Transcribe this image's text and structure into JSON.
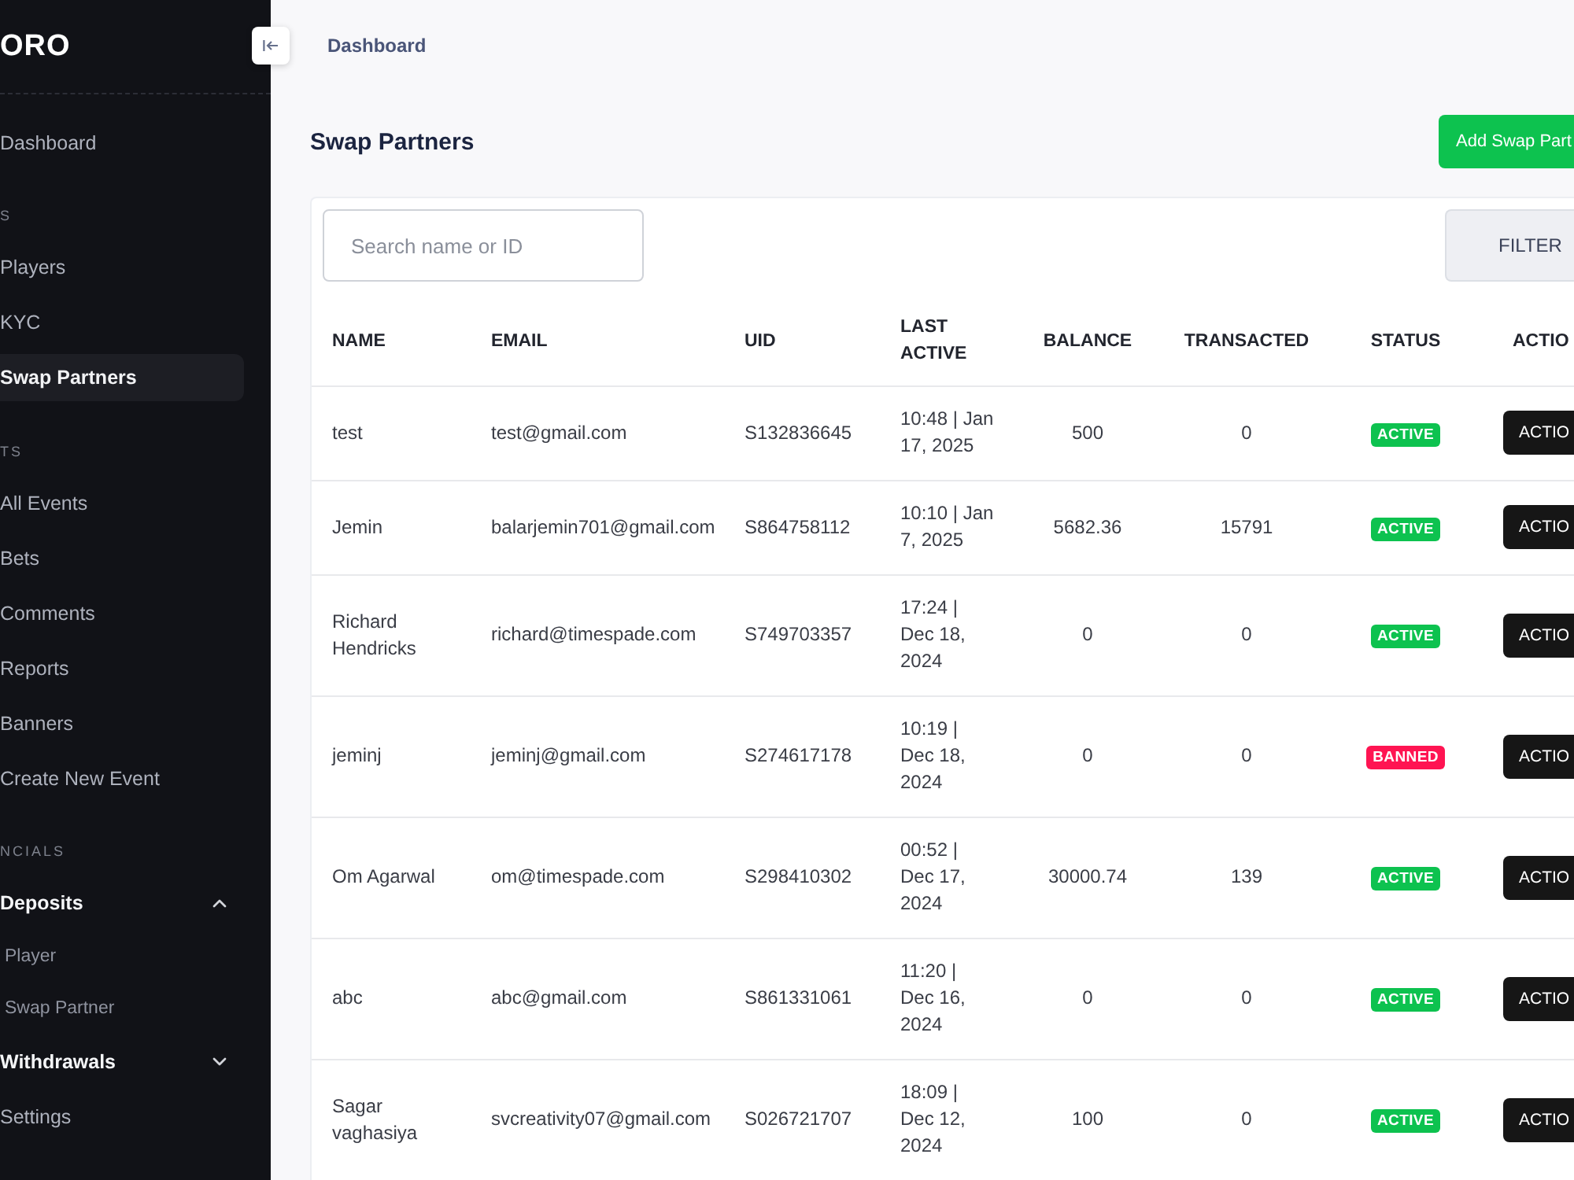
{
  "sidebar": {
    "logo": "ORO",
    "items": [
      {
        "kind": "link",
        "label": "Dashboard",
        "selected": false
      },
      {
        "kind": "section",
        "label": "S"
      },
      {
        "kind": "link",
        "label": "Players",
        "selected": false
      },
      {
        "kind": "link",
        "label": "KYC",
        "selected": false
      },
      {
        "kind": "link",
        "label": "Swap Partners",
        "selected": true
      },
      {
        "kind": "section",
        "label": "TS"
      },
      {
        "kind": "link",
        "label": "All Events",
        "selected": false
      },
      {
        "kind": "link",
        "label": "Bets",
        "selected": false
      },
      {
        "kind": "link",
        "label": "Comments",
        "selected": false
      },
      {
        "kind": "link",
        "label": "Reports",
        "selected": false
      },
      {
        "kind": "link",
        "label": "Banners",
        "selected": false
      },
      {
        "kind": "link",
        "label": "Create New Event",
        "selected": false
      },
      {
        "kind": "section",
        "label": "NCIALS"
      },
      {
        "kind": "group",
        "label": "Deposits",
        "expanded": true,
        "children": [
          {
            "label": "Player",
            "selected": false
          },
          {
            "label": "Swap Partner",
            "selected": false
          }
        ]
      },
      {
        "kind": "group",
        "label": "Withdrawals",
        "expanded": false
      },
      {
        "kind": "link",
        "label": "Settings",
        "selected": false
      }
    ]
  },
  "breadcrumb": {
    "label": "Dashboard"
  },
  "page": {
    "title": "Swap Partners",
    "add_button": "Add Swap Part"
  },
  "search": {
    "placeholder": "Search name or ID"
  },
  "filter_button": "FILTER",
  "table": {
    "columns": [
      "NAME",
      "EMAIL",
      "UID",
      "LAST ACTIVE",
      "BALANCE",
      "TRANSACTED",
      "STATUS",
      "ACTIO"
    ],
    "rows": [
      {
        "name": "test",
        "email": "test@gmail.com",
        "uid": "S132836645",
        "last_active": "10:48 | Jan\n17, 2025",
        "balance": "500",
        "transacted": "0",
        "status": {
          "label": "ACTIVE",
          "kind": "active"
        },
        "action": "ACTIO"
      },
      {
        "name": "Jemin",
        "email": "balarjemin701@gmail.com",
        "uid": "S864758112",
        "last_active": "10:10 | Jan\n7, 2025",
        "balance": "5682.36",
        "transacted": "15791",
        "status": {
          "label": "ACTIVE",
          "kind": "active"
        },
        "action": "ACTIO"
      },
      {
        "name": "Richard Hendricks",
        "email": "richard@timespade.com",
        "uid": "S749703357",
        "last_active": "17:24 |\nDec 18,\n2024",
        "balance": "0",
        "transacted": "0",
        "status": {
          "label": "ACTIVE",
          "kind": "active"
        },
        "action": "ACTIO"
      },
      {
        "name": "jeminj",
        "email": "jeminj@gmail.com",
        "uid": "S274617178",
        "last_active": "10:19 |\nDec 18,\n2024",
        "balance": "0",
        "transacted": "0",
        "status": {
          "label": "BANNED",
          "kind": "banned"
        },
        "action": "ACTIO"
      },
      {
        "name": "Om Agarwal",
        "email": "om@timespade.com",
        "uid": "S298410302",
        "last_active": "00:52 |\nDec 17,\n2024",
        "balance": "30000.74",
        "transacted": "139",
        "status": {
          "label": "ACTIVE",
          "kind": "active"
        },
        "action": "ACTIO"
      },
      {
        "name": "abc",
        "email": "abc@gmail.com",
        "uid": "S861331061",
        "last_active": "11:20 |\nDec 16,\n2024",
        "balance": "0",
        "transacted": "0",
        "status": {
          "label": "ACTIVE",
          "kind": "active"
        },
        "action": "ACTIO"
      },
      {
        "name": "Sagar vaghasiya",
        "email": "svcreativity07@gmail.com",
        "uid": "S026721707",
        "last_active": "18:09 |\nDec 12,\n2024",
        "balance": "100",
        "transacted": "0",
        "status": {
          "label": "ACTIVE",
          "kind": "active"
        },
        "action": "ACTIO"
      }
    ]
  }
}
